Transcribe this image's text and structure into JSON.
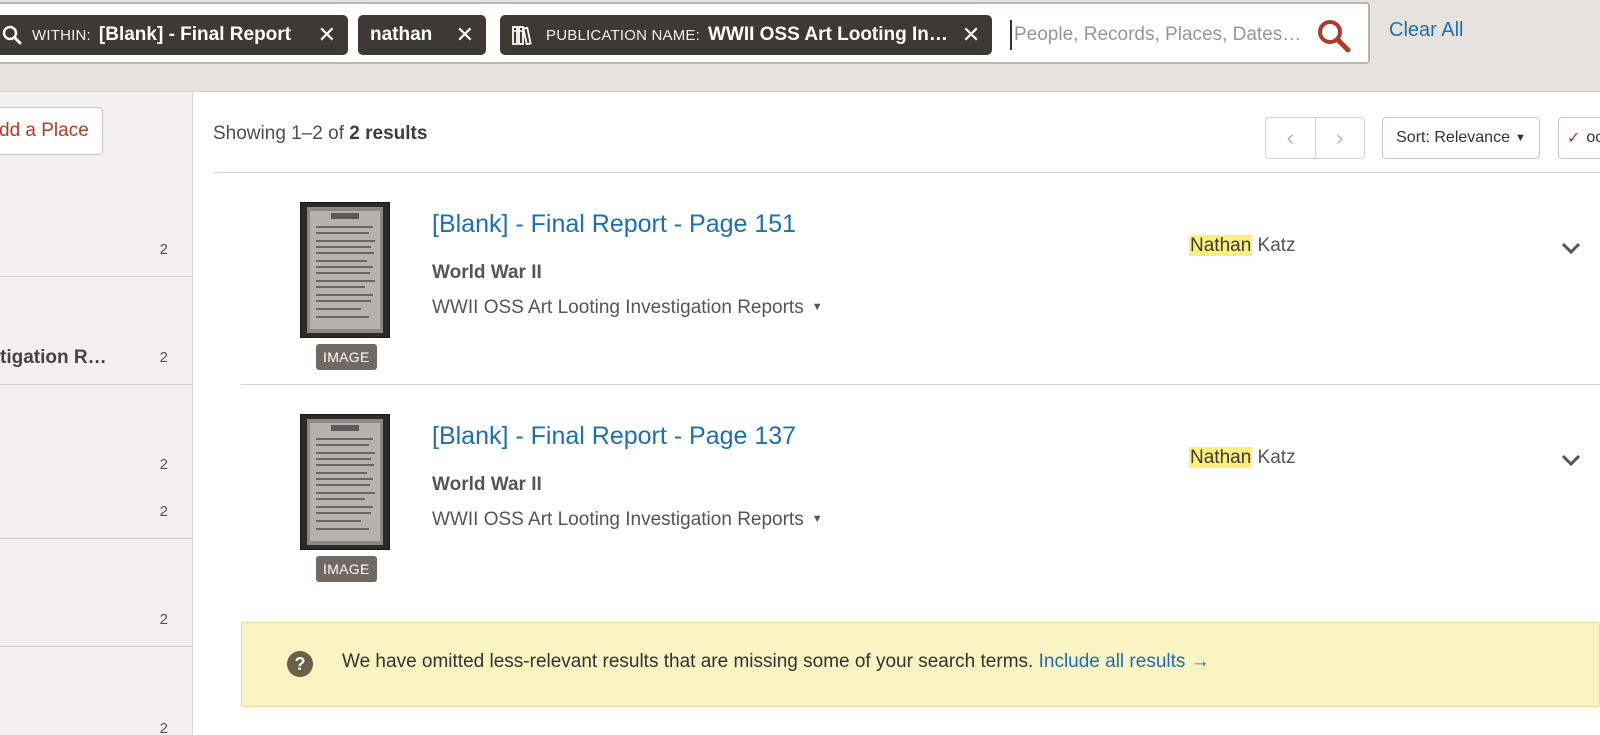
{
  "filters": {
    "within": {
      "label": "WITHIN:",
      "value": "[Blank] - Final Report",
      "remove": "✕"
    },
    "keyword": {
      "value": "nathan",
      "remove": "✕"
    },
    "publication": {
      "label": "PUBLICATION NAME:",
      "value": "WWII OSS Art Looting In…",
      "remove": "✕"
    },
    "search_placeholder": "People, Records, Places, Dates…",
    "clear_all": "Clear All"
  },
  "sidebar": {
    "add_place": "dd a Place",
    "facets": [
      {
        "label": "",
        "count": "2"
      },
      {
        "label": "tigation R…",
        "count": "2"
      },
      {
        "label": "",
        "count": "2"
      },
      {
        "label": "",
        "count": "2"
      },
      {
        "label": "",
        "count": "2"
      },
      {
        "label": "",
        "count": "2"
      }
    ]
  },
  "results_header": {
    "showing_prefix": "Showing 1–2 of ",
    "showing_total": "2 results",
    "prev": "‹",
    "next": "›",
    "sort_label": "Sort: Relevance",
    "odd_label": "oc"
  },
  "results": [
    {
      "title": "[Blank] - Final Report - Page 151",
      "collection": "World War II",
      "publication": "WWII OSS Art Looting Investigation Reports",
      "badge": "IMAGE",
      "name_highlight": "Nathan",
      "name_rest": " Katz"
    },
    {
      "title": "[Blank] - Final Report - Page 137",
      "collection": "World War II",
      "publication": "WWII OSS Art Looting Investigation Reports",
      "badge": "IMAGE",
      "name_highlight": "Nathan",
      "name_rest": " Katz"
    }
  ],
  "notice": {
    "icon": "?",
    "message": "We have omitted less-relevant results that are missing some of your search terms. ",
    "link": "Include all results →"
  },
  "colors": {
    "accent_link": "#1c6fb5",
    "accent_red": "#b23a2b",
    "chip_bg": "#3d3a36",
    "highlight": "#fbf07a",
    "notice_bg": "#faf3c2"
  }
}
